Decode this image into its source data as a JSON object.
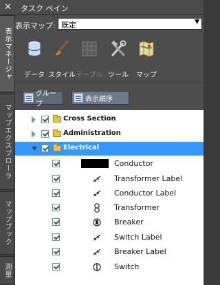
{
  "window": {
    "title": "タスク ペイン",
    "close_glyph": "✕"
  },
  "side_tabs": [
    {
      "label": "表示マネージャ",
      "active": true
    },
    {
      "label": "マップエクスプローラ",
      "active": false
    },
    {
      "label": "マップブック",
      "active": false
    },
    {
      "label": "測量",
      "active": false
    }
  ],
  "map_selector": {
    "label": "表示マップ:",
    "value": "既定"
  },
  "toolbar": {
    "data": "データ",
    "style": "スタイル",
    "table": "テーブル",
    "tools": "ツール",
    "map": "マップ"
  },
  "view_buttons": {
    "group": "グループ",
    "draw_order": "表示順序"
  },
  "tree": {
    "groups": [
      {
        "label": "Cross Section",
        "expanded": false
      },
      {
        "label": "Administration",
        "expanded": false
      },
      {
        "label": "Electrical",
        "expanded": true,
        "selected": true
      }
    ],
    "layers": [
      {
        "label": "Conductor",
        "icon": "conductor-line-swatch"
      },
      {
        "label": "Transformer Label",
        "icon": "label-icon"
      },
      {
        "label": "Conductor Label",
        "icon": "label-icon"
      },
      {
        "label": "Transformer",
        "icon": "transformer-symbol-icon"
      },
      {
        "label": "Breaker",
        "icon": "breaker-symbol-icon"
      },
      {
        "label": "Switch Label",
        "icon": "label-icon"
      },
      {
        "label": "Breaker Label",
        "icon": "label-icon"
      },
      {
        "label": "Switch",
        "icon": "switch-symbol-icon"
      }
    ]
  },
  "colors": {
    "selection": "#3399ff",
    "panel": "#4d4d4d",
    "folder": "#f0c040",
    "check": "#2d6a2d"
  }
}
